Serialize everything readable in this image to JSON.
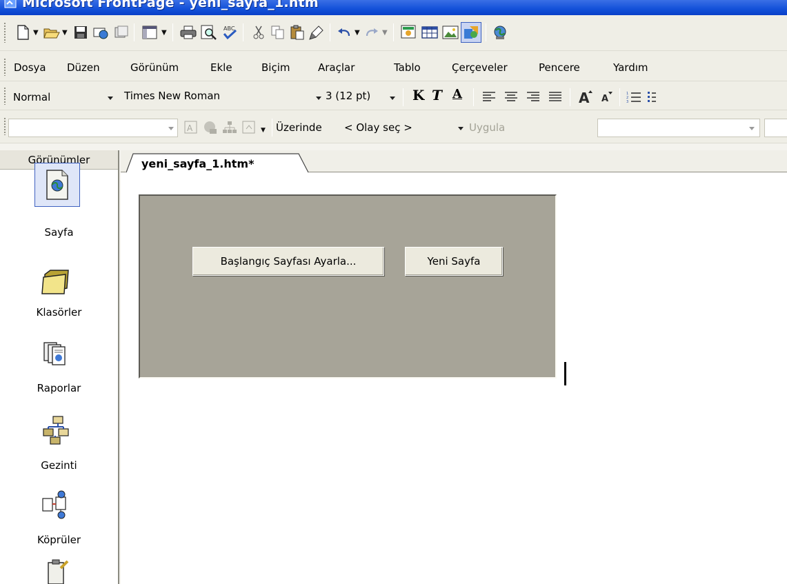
{
  "window": {
    "title": "Microsoft FrontPage - yeni_sayfa_1.htm",
    "icon": "frontpage-app-icon"
  },
  "menu": {
    "items": [
      {
        "label": "Dosya"
      },
      {
        "label": "Düzen"
      },
      {
        "label": "Görünüm"
      },
      {
        "label": "Ekle"
      },
      {
        "label": "Biçim"
      },
      {
        "label": "Araçlar"
      },
      {
        "label": "Tablo"
      },
      {
        "label": "Çerçeveler"
      },
      {
        "label": "Pencere"
      },
      {
        "label": "Yardım"
      }
    ]
  },
  "standard_toolbar": {
    "icons": [
      "new-page-icon",
      "open-folder-icon",
      "save-icon",
      "publish-icon",
      "web-component-icon",
      "toggle-pane-icon",
      "print-icon",
      "print-preview-icon",
      "spelling-icon",
      "cut-icon",
      "copy-icon",
      "paste-icon",
      "format-painter-icon",
      "undo-icon",
      "redo-icon",
      "insert-component-icon",
      "insert-table-icon",
      "insert-picture-icon",
      "drawing-icon",
      "hyperlink-icon"
    ]
  },
  "formatting_toolbar": {
    "style": "Normal",
    "font": "Times New Roman",
    "size": "3  (12 pt)",
    "bold_label": "K",
    "italic_label": "T",
    "underline_label": "A"
  },
  "dhtml_toolbar": {
    "on_label": "Üzerinde",
    "event_value": "< Olay seç >",
    "apply_label": "Uygula"
  },
  "views": {
    "header": "Görünümler",
    "items": [
      {
        "label": "Sayfa",
        "icon": "page-view-icon",
        "active": true
      },
      {
        "label": "Klasörler",
        "icon": "folder-view-icon",
        "active": false
      },
      {
        "label": "Raporlar",
        "icon": "reports-view-icon",
        "active": false
      },
      {
        "label": "Gezinti",
        "icon": "navigation-view-icon",
        "active": false
      },
      {
        "label": "Köprüler",
        "icon": "hyperlinks-view-icon",
        "active": false
      }
    ]
  },
  "editor": {
    "tab_label": "yeni_sayfa_1.htm*",
    "buttons": [
      {
        "label": "Başlangıç Sayfası Ayarla..."
      },
      {
        "label": "Yeni Sayfa"
      }
    ]
  },
  "colors": {
    "titlebar": "#1250d8",
    "toolbar": "#efeee6",
    "doc_box": "#a7a498"
  }
}
